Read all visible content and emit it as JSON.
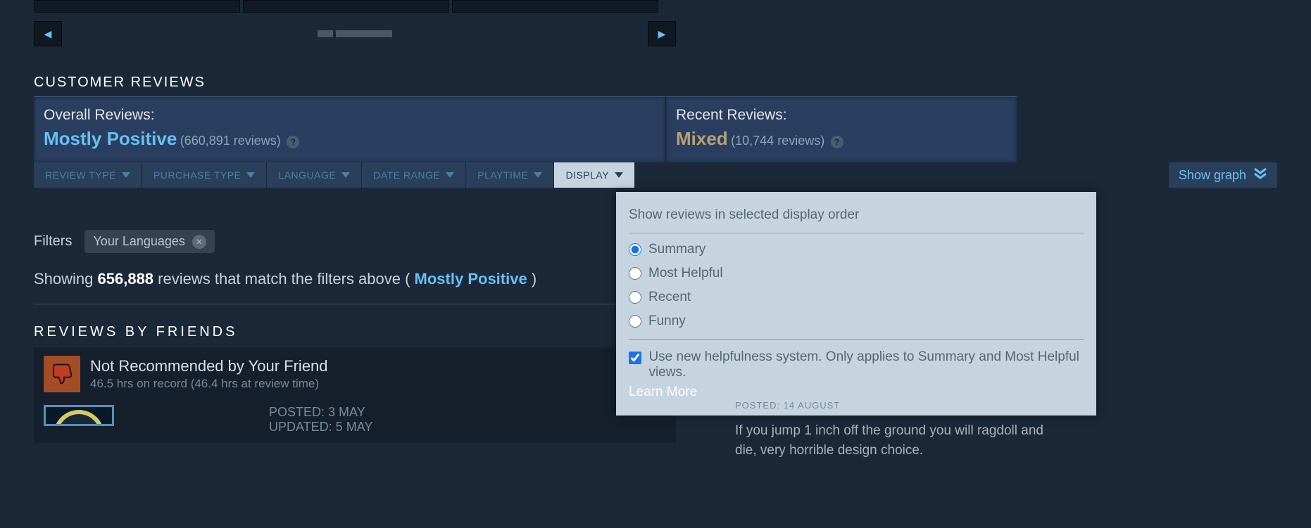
{
  "section_title": "CUSTOMER REVIEWS",
  "overall": {
    "label": "Overall Reviews:",
    "rating": "Mostly Positive",
    "count": "(660,891 reviews)"
  },
  "recent": {
    "label": "Recent Reviews:",
    "rating": "Mixed",
    "count": "(10,744 reviews)"
  },
  "filters": {
    "review_type": "REVIEW TYPE",
    "purchase_type": "PURCHASE TYPE",
    "language": "LANGUAGE",
    "date_range": "DATE RANGE",
    "playtime": "PLAYTIME",
    "display": "DISPLAY"
  },
  "show_graph": "Show graph",
  "filters_label": "Filters",
  "chip_your_languages": "Your Languages",
  "results_showing": "Showing ",
  "results_count": "656,888",
  "results_tail": " reviews that match the filters above ( ",
  "results_rating": "Mostly Positive",
  "results_close": " )",
  "friends_title": "REVIEWS BY FRIENDS",
  "friend_review": {
    "title": "Not Recommended by Your Friend",
    "subtitle": "46.5 hrs on record (46.4 hrs at review time)",
    "posted": "POSTED: 3 MAY",
    "updated": "UPDATED: 5 MAY"
  },
  "display_popup": {
    "header": "Show reviews in selected display order",
    "opt_summary": "Summary",
    "opt_helpful": "Most Helpful",
    "opt_recent": "Recent",
    "opt_funny": "Funny",
    "checkbox_label": "Use new helpfulness system. Only applies to Summary and Most Helpful views.",
    "learn_more": "Learn More"
  },
  "snippet": {
    "meta": "POSTED: 14 AUGUST",
    "body": "If you jump 1 inch off the ground you will ragdoll and die, very horrible design choice."
  },
  "carousel": {
    "left": "◀",
    "right": "▶"
  },
  "chevrons": "⌄"
}
